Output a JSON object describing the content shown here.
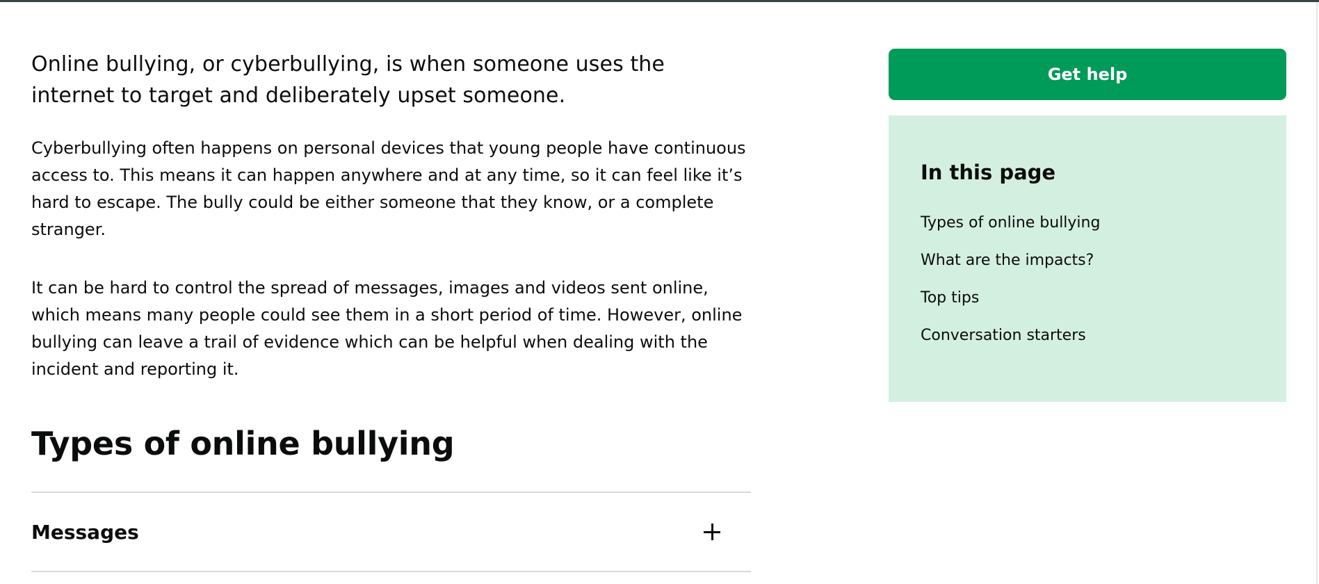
{
  "main": {
    "lead": "Online bullying, or cyberbullying, is when someone uses the internet to target and deliberately upset someone.",
    "paragraphs": [
      "Cyberbullying often happens on personal devices that young people have continuous access to. This means it can happen anywhere and at any time, so it can feel like it’s hard to escape. The bully could be either someone that they know, or a complete stranger.",
      "It can be hard to control the spread of messages, images and videos sent online, which means many people could see them in a short period of time. However, online bullying can leave a trail of evidence which can be helpful when dealing with the incident and reporting it."
    ],
    "section_heading": "Types of online bullying",
    "accordion": [
      {
        "title": "Messages",
        "icon": "plus-icon"
      }
    ]
  },
  "sidebar": {
    "get_help_label": "Get help",
    "toc_title": "In this page",
    "toc_items": [
      "Types of online bullying",
      "What are the impacts?",
      "Top tips",
      "Conversation starters"
    ]
  },
  "colors": {
    "button_green": "#009a59",
    "toc_background": "#d3efe0",
    "text": "#0b0c0c",
    "divider": "#d7d9da"
  }
}
